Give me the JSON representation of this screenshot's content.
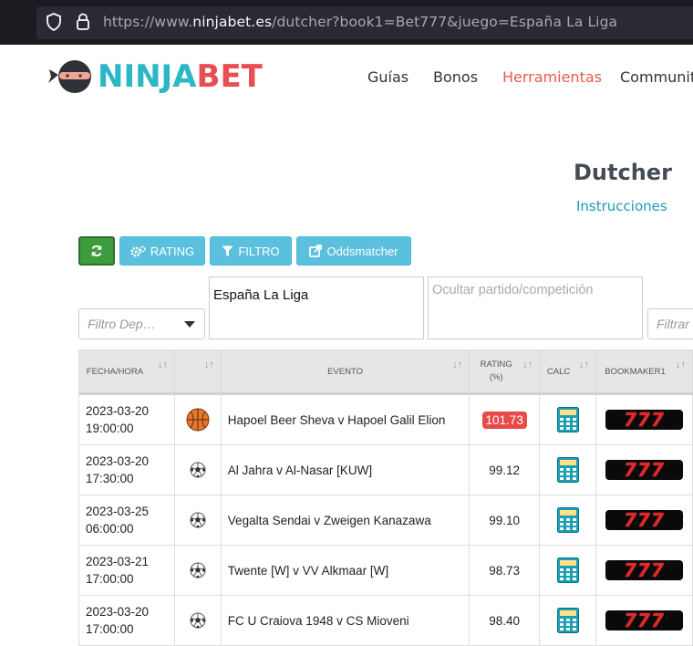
{
  "browser": {
    "url_prefix": "https://www.",
    "url_domain": "ninjabet.es",
    "url_rest": "/dutcher?book1=Bet777&juego=España La Liga"
  },
  "brand": {
    "logo_part1": "NINJA",
    "logo_part2": "BET"
  },
  "nav": {
    "guias": "Guías",
    "bonos": "Bonos",
    "herramientas": "Herramientas",
    "community": "Community"
  },
  "page": {
    "title": "Dutcher",
    "instructions": "Instrucciones"
  },
  "toolbar": {
    "rating": "RATING",
    "filtro": "FILTRO",
    "oddsmatcher": "Oddsmatcher"
  },
  "filters": {
    "sport_placeholder": "Filtro Dep…",
    "competition_value": "España La Liga",
    "hide_placeholder": "Ocultar partido/competición",
    "filter_placeholder": "Filtrar"
  },
  "table": {
    "headers": {
      "fecha": "FECHA/HORA",
      "evento": "EVENTO",
      "rating_l1": "RATING",
      "rating_l2": "(%)",
      "calc": "CALC",
      "bookmaker": "BOOKMAKER1"
    },
    "bookmaker_logo": "777",
    "rows": [
      {
        "date": "2023-03-20",
        "time": "19:00:00",
        "sport": "basketball-icon",
        "event": "Hapoel Beer Sheva v Hapoel Galil Elion",
        "rating": "101.73",
        "highlight": true
      },
      {
        "date": "2023-03-20",
        "time": "17:30:00",
        "sport": "football-icon",
        "event": "Al Jahra v Al-Nasar [KUW]",
        "rating": "99.12",
        "highlight": false
      },
      {
        "date": "2023-03-25",
        "time": "06:00:00",
        "sport": "football-icon",
        "event": "Vegalta Sendai v Zweigen Kanazawa",
        "rating": "99.10",
        "highlight": false
      },
      {
        "date": "2023-03-21",
        "time": "17:00:00",
        "sport": "football-icon",
        "event": "Twente [W] v VV Alkmaar [W]",
        "rating": "98.73",
        "highlight": false
      },
      {
        "date": "2023-03-20",
        "time": "17:00:00",
        "sport": "football-icon",
        "event": "FC U Craiova 1948 v CS Mioveni",
        "rating": "98.40",
        "highlight": false
      }
    ]
  },
  "colors": {
    "brand_cyan": "#2bb7c5",
    "brand_red": "#e94f52",
    "button_cyan": "#5bc0de",
    "refresh_green": "#3e9b3e",
    "rating_highlight": "#e84a4a"
  }
}
